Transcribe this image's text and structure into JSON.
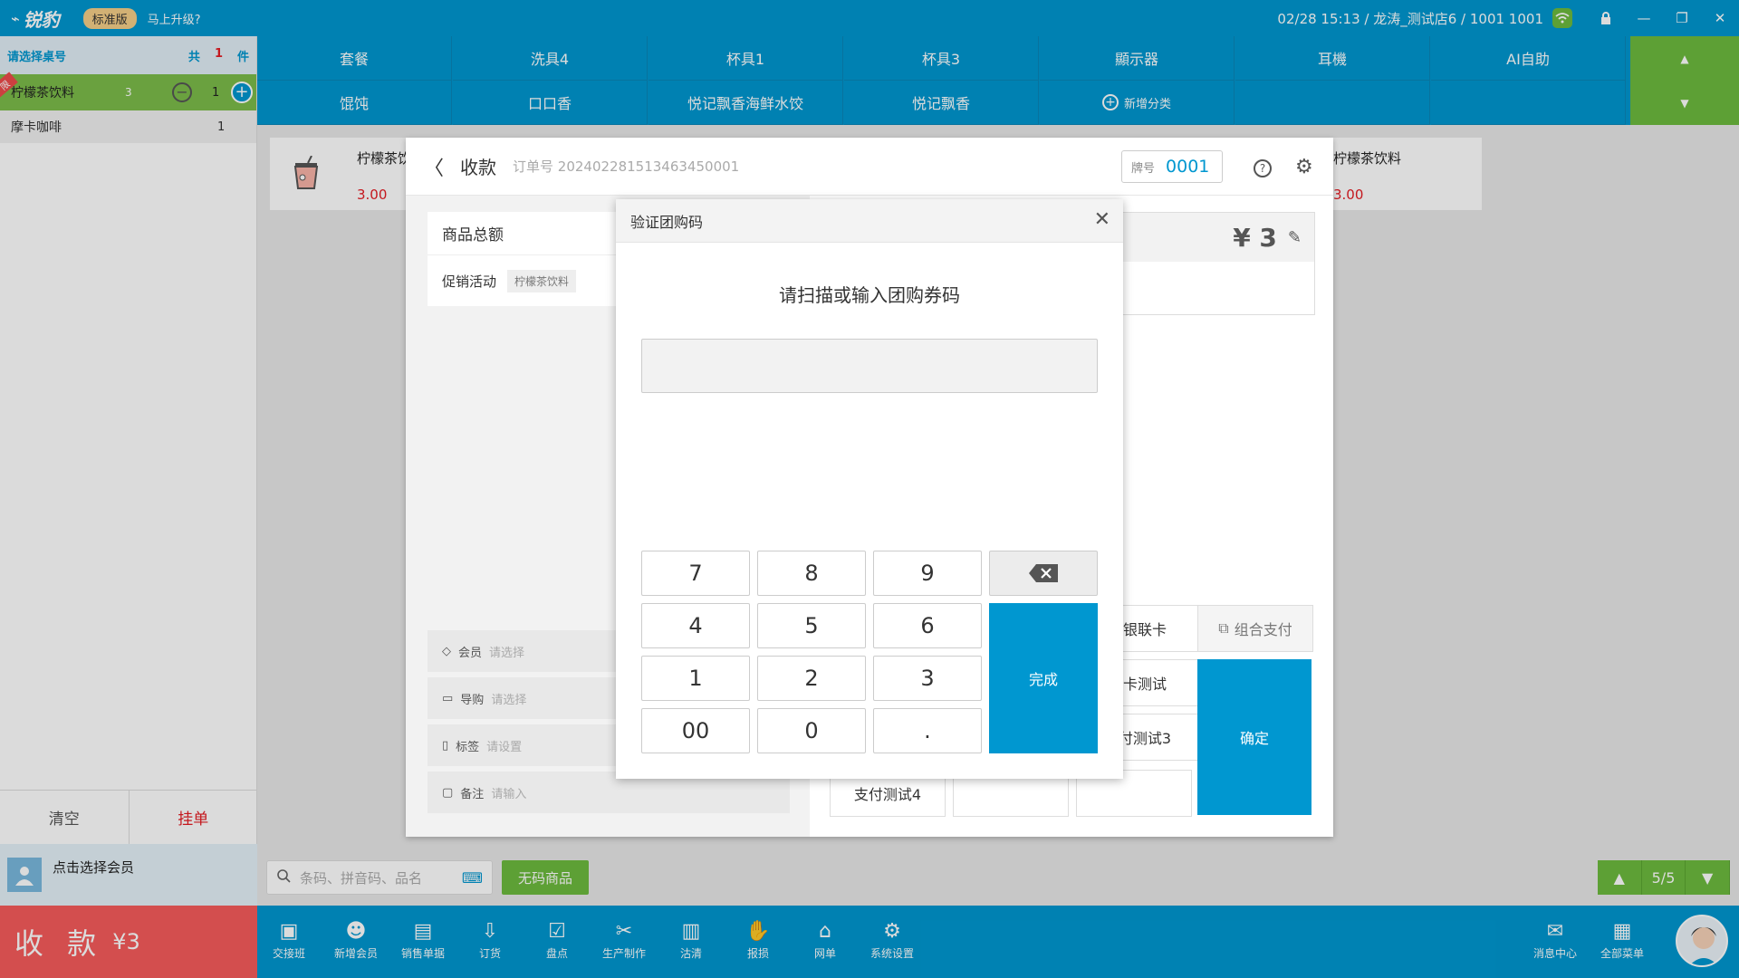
{
  "app": {
    "logo": "锐豹",
    "edition_badge": "标准版",
    "upgrade_link": "马上升级?",
    "header_info": "02/28 15:13 / 龙涛_测试店6 / 1001 1001"
  },
  "cart": {
    "header_label": "请选择桌号",
    "total_prefix": "共",
    "total_count": "1",
    "total_suffix": "件",
    "items": [
      {
        "tag": "限",
        "name": "柠檬茶饮料",
        "stock": "3",
        "qty": "1"
      },
      {
        "name": "摩卡咖啡",
        "qty": "1"
      }
    ],
    "clear_label": "清空",
    "hold_label": "挂单",
    "member_prompt": "点击选择会员"
  },
  "checkout": {
    "label": "收 款",
    "amount": "¥3"
  },
  "categories": {
    "row1": [
      "套餐",
      "洗具4",
      "杯具1",
      "杯具3",
      "顯示器",
      "耳機",
      "AI自助"
    ],
    "row2": [
      "馄饨",
      "口口香",
      "悦记飘香海鲜水饺",
      "悦记飘香"
    ],
    "add_label": "新增分类"
  },
  "products": [
    {
      "name": "柠檬茶饮料",
      "price": "3.00"
    },
    {
      "name": "柠檬茶饮料",
      "price": "3.00"
    }
  ],
  "search": {
    "placeholder": "条码、拼音码、品名"
  },
  "no_code_label": "无码商品",
  "pager": {
    "page": "5/5"
  },
  "toolbar": [
    {
      "label": "交接班",
      "icon": "handover-icon"
    },
    {
      "label": "新增会员",
      "icon": "add-member-icon"
    },
    {
      "label": "销售单据",
      "icon": "sales-doc-icon"
    },
    {
      "label": "订货",
      "icon": "order-icon"
    },
    {
      "label": "盘点",
      "icon": "inventory-icon"
    },
    {
      "label": "生产制作",
      "icon": "production-icon"
    },
    {
      "label": "沽清",
      "icon": "soldout-icon"
    },
    {
      "label": "报损",
      "icon": "loss-icon"
    },
    {
      "label": "网单",
      "icon": "web-order-icon"
    },
    {
      "label": "系统设置",
      "icon": "settings-icon"
    },
    {
      "label": "消息中心",
      "icon": "message-icon"
    },
    {
      "label": "全部菜单",
      "icon": "all-menu-icon"
    }
  ],
  "collect": {
    "title": "收款",
    "order_no": "订单号 20240228151346345000­1",
    "plate_label": "牌号",
    "plate_no": "0001",
    "total_label": "商品总额",
    "promo_label": "促销活动",
    "promo_value": "柠檬茶饮料",
    "amount": "¥ 3",
    "options": [
      {
        "label": "会员",
        "placeholder": "请选择"
      },
      {
        "label": "导购",
        "placeholder": "请选择"
      },
      {
        "label": "标签",
        "placeholder": "请设置"
      },
      {
        "label": "备注",
        "placeholder": "请输入"
      }
    ],
    "pay_buttons": [
      "银联卡",
      "组合支付",
      "卡测试",
      "付测试3",
      "支付测试4"
    ],
    "confirm_label": "确定"
  },
  "verify": {
    "title": "验证团购码",
    "prompt": "请扫描或输入团购券码",
    "input_value": "",
    "keys": [
      "7",
      "8",
      "9",
      "4",
      "5",
      "6",
      "1",
      "2",
      "3",
      "00",
      "0",
      "."
    ],
    "done_label": "完成"
  },
  "colors": {
    "primary": "#0097d0",
    "accent_green": "#6dbb3e",
    "danger": "#f65b5b"
  }
}
